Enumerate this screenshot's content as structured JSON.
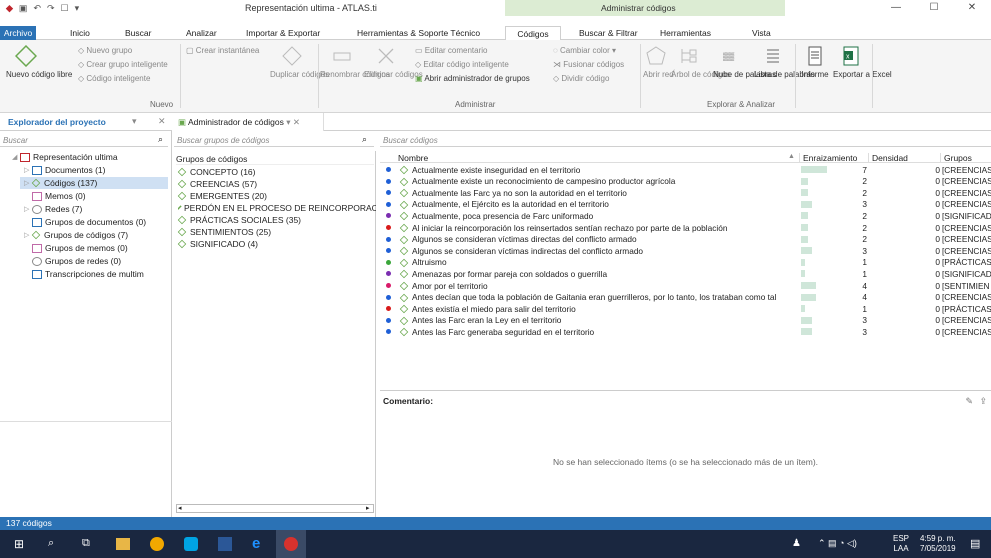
{
  "window": {
    "title": "Representación ultima - ATLAS.ti",
    "context_tab_title": "Administrar códigos",
    "controls": [
      "—",
      "☐",
      "✕"
    ]
  },
  "tabs": [
    {
      "label": "Archivo"
    },
    {
      "label": "Inicio"
    },
    {
      "label": "Buscar"
    },
    {
      "label": "Analizar"
    },
    {
      "label": "Importar & Exportar"
    },
    {
      "label": "Herramientas & Soporte Técnico"
    },
    {
      "label": "Códigos"
    },
    {
      "label": "Buscar & Filtrar"
    },
    {
      "label": "Herramientas"
    },
    {
      "label": "Vista"
    }
  ],
  "ribbon": {
    "new_free_code": "Nuevo código libre",
    "new_group": "Nuevo grupo",
    "new_smart_group": "Crear grupo inteligente",
    "smart_code": "Código inteligente",
    "create_snapshot": "Crear instantánea",
    "duplicate_codes": "Duplicar códigos",
    "rename_codes": "Renombrar códigos",
    "delete_codes": "Eliminar códigos",
    "edit_comment": "Editar comentario",
    "edit_smart_code": "Editar código inteligente",
    "open_group_manager": "Abrir administrador de grupos",
    "change_color": "Cambiar color",
    "merge_codes": "Fusionar códigos",
    "split_code": "Dividir código",
    "open_net": "Abrir red",
    "code_tree": "Árbol de códigos",
    "word_cloud": "Nube de palabras",
    "word_list": "Lista de palabras",
    "report": "Informe",
    "export_excel": "Exportar a Excel",
    "group_new": "Nuevo",
    "group_admin": "Administrar",
    "group_explore": "Explorar & Analizar"
  },
  "explorer": {
    "title": "Explorador del proyecto",
    "search_placeholder": "Buscar",
    "items": [
      {
        "label": "Representación ultima"
      },
      {
        "label": "Documentos (1)"
      },
      {
        "label": "Códigos (137)"
      },
      {
        "label": "Memos (0)"
      },
      {
        "label": "Redes (7)"
      },
      {
        "label": "Grupos de documentos (0)"
      },
      {
        "label": "Grupos de códigos (7)"
      },
      {
        "label": "Grupos de memos (0)"
      },
      {
        "label": "Grupos de redes (0)"
      },
      {
        "label": "Transcripciones de multim"
      }
    ]
  },
  "code_manager": {
    "tab_title": "Administrador de códigos",
    "groups_search_placeholder": "Buscar grupos de códigos",
    "codes_search_placeholder": "Buscar códigos",
    "groups_header": "Grupos de códigos",
    "groups": [
      {
        "label": "CONCEPTO (16)"
      },
      {
        "label": "CREENCIAS (57)"
      },
      {
        "label": "EMERGENTES (20)"
      },
      {
        "label": "PERDÓN EN EL PROCESO DE REINCORPORACIÓN"
      },
      {
        "label": "PRÁCTICAS SOCIALES (35)"
      },
      {
        "label": "SENTIMIENTOS (25)"
      },
      {
        "label": "SIGNIFICADO (4)"
      }
    ],
    "columns": {
      "name": "Nombre",
      "grounded": "Enraizamiento",
      "density": "Densidad",
      "groups": "Grupos"
    },
    "codes": [
      {
        "name": "Actualmente existe inseguridad en el territorio",
        "grounded": 7,
        "density": 0,
        "groups": "[CREENCIAS]",
        "color": "#1f5fd6"
      },
      {
        "name": "Actualmente existe un reconocimiento de campesino productor agrícola",
        "grounded": 2,
        "density": 0,
        "groups": "[CREENCIAS]",
        "color": "#1f5fd6"
      },
      {
        "name": "Actualmente las Farc ya no son la autoridad en el territorio",
        "grounded": 2,
        "density": 0,
        "groups": "[CREENCIAS]",
        "color": "#1f5fd6"
      },
      {
        "name": "Actualmente, el Ejército es la autoridad en el territorio",
        "grounded": 3,
        "density": 0,
        "groups": "[CREENCIAS]",
        "color": "#1f5fd6"
      },
      {
        "name": "Actualmente, poca presencia de Farc uniformado",
        "grounded": 2,
        "density": 0,
        "groups": "[SIGNIFICADO]",
        "color": "#7b2db0"
      },
      {
        "name": "Al iniciar la reincorporación los reinsertados sentían rechazo por parte de la población",
        "grounded": 2,
        "density": 0,
        "groups": "[CREENCIAS]",
        "color": "#d81b1b"
      },
      {
        "name": "Algunos se consideran víctimas directas del conflicto armado",
        "grounded": 2,
        "density": 0,
        "groups": "[CREENCIAS]",
        "color": "#1f5fd6"
      },
      {
        "name": "Algunos se consideran víctimas indirectas del conflicto armado",
        "grounded": 3,
        "density": 0,
        "groups": "[CREENCIAS]",
        "color": "#1f5fd6"
      },
      {
        "name": "Altruismo",
        "grounded": 1,
        "density": 0,
        "groups": "[PRÁCTICAS",
        "color": "#3aa63a"
      },
      {
        "name": "Amenazas por formar pareja con soldados o guerrilla",
        "grounded": 1,
        "density": 0,
        "groups": "[SIGNIFICAD",
        "color": "#7b2db0"
      },
      {
        "name": "Amor por el territorio",
        "grounded": 4,
        "density": 0,
        "groups": "[SENTIMIEN",
        "color": "#d81b6a"
      },
      {
        "name": "Antes decían que toda la población de Gaitania eran guerrilleros, por lo tanto, los trataban como tal",
        "grounded": 4,
        "density": 0,
        "groups": "[CREENCIAS]",
        "color": "#1f5fd6"
      },
      {
        "name": "Antes existía el miedo para salir del territorio",
        "grounded": 1,
        "density": 0,
        "groups": "[PRÁCTICAS",
        "color": "#d81b1b"
      },
      {
        "name": "Antes las Farc eran la Ley en el territorio",
        "grounded": 3,
        "density": 0,
        "groups": "[CREENCIAS]",
        "color": "#1f5fd6"
      },
      {
        "name": "Antes las Farc generaba seguridad en el territorio",
        "grounded": 3,
        "density": 0,
        "groups": "[CREENCIAS]",
        "color": "#1f5fd6"
      }
    ],
    "comment_label": "Comentario:",
    "empty_message": "No se han seleccionado ítems (o se ha seleccionado más de un ítem)."
  },
  "status": {
    "text": "137 códigos"
  },
  "taskbar": {
    "lang": "ESP",
    "lang2": "LAA",
    "time": "4:59 p. m.",
    "date": "7/05/2019"
  }
}
